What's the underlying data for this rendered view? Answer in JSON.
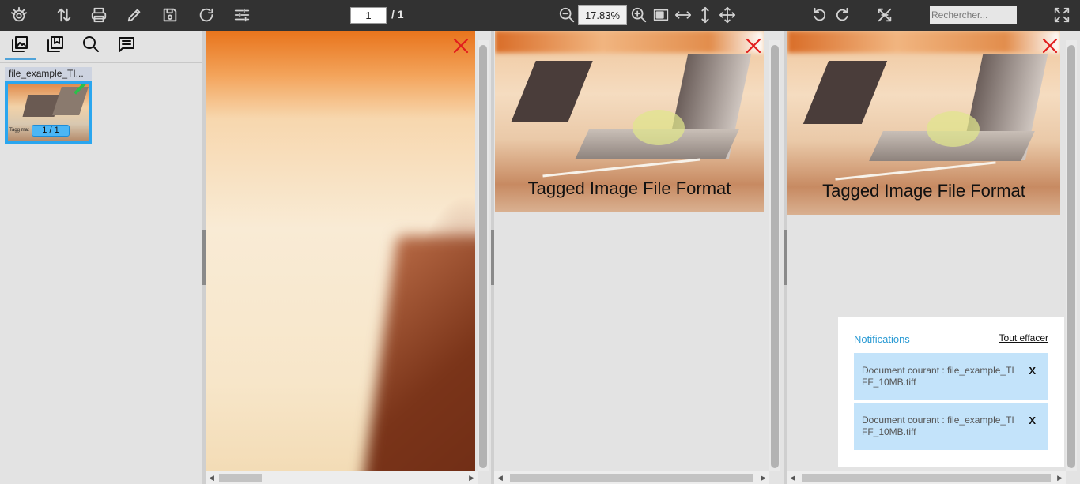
{
  "toolbar": {
    "page_input": "1",
    "page_total": "/ 1",
    "zoom_value": "17.83%",
    "search_placeholder": "Rechercher..."
  },
  "sidebar": {
    "tabs": [
      "thumbnails-icon",
      "bookmarks-icon",
      "search-icon",
      "comments-icon"
    ],
    "thumbnail": {
      "name": "file_example_TI...",
      "page_label": "1 / 1",
      "caption": "Tagg                mat"
    }
  },
  "panes": [
    {
      "caption": ""
    },
    {
      "caption": "Tagged Image File Format"
    },
    {
      "caption": "Tagged Image File Format"
    }
  ],
  "notifications": {
    "title": "Notifications",
    "clear_label": "Tout effacer",
    "items": [
      {
        "text": "Document courant : file_example_TIFF_10MB.tiff",
        "close": "X"
      },
      {
        "text": "Document courant : file_example_TIFF_10MB.tiff",
        "close": "X"
      }
    ]
  },
  "colors": {
    "toolbar_bg": "#323232",
    "accent": "#2b9bd4",
    "close_red": "#e11d1d",
    "notif_bg": "#c3e3fa"
  }
}
